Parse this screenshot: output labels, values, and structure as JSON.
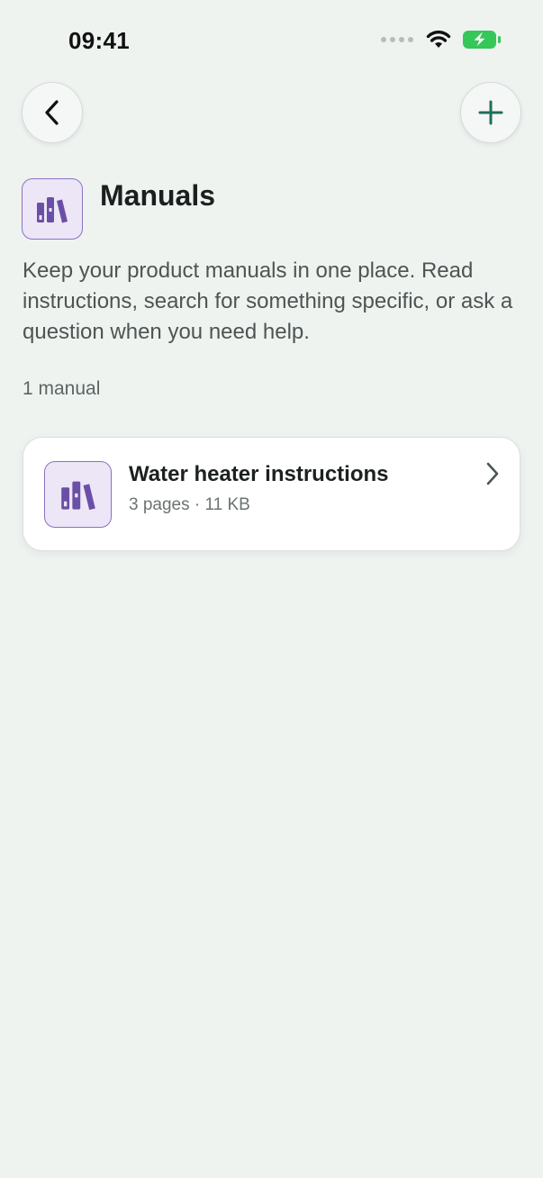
{
  "status_bar": {
    "time": "09:41"
  },
  "nav": {
    "back_icon": "chevron-left-icon",
    "add_icon": "plus-icon"
  },
  "header": {
    "icon": "books-icon",
    "title": "Manuals",
    "description": "Keep your product manuals in one place. Read instructions, search for something specific, or ask a question when you need help.",
    "count": "1 manual"
  },
  "manuals": [
    {
      "icon": "books-icon",
      "title": "Water heater instructions",
      "meta": "3 pages · 11 KB"
    }
  ],
  "colors": {
    "background": "#eef3f0",
    "accent_purple": "#6b4fa6",
    "icon_tile": "#ece6f7",
    "plus_green": "#1f6f5c",
    "battery_green": "#35c759"
  }
}
